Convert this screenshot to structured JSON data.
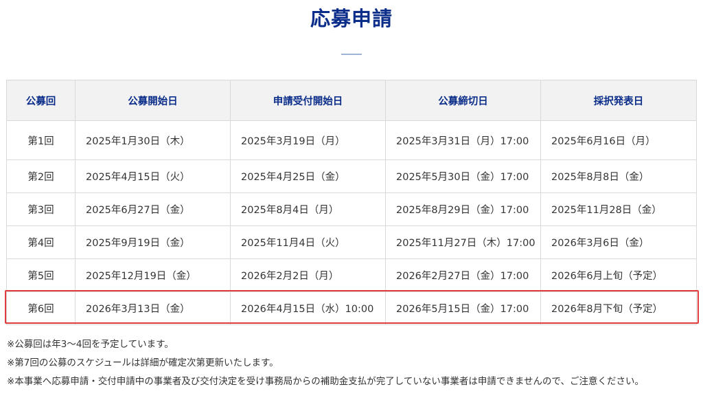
{
  "page": {
    "title": "応募申請"
  },
  "table": {
    "headers": [
      "公募回",
      "公募開始日",
      "申請受付開始日",
      "公募締切日",
      "採択発表日"
    ],
    "rows": [
      [
        "第1回",
        "2025年1月30日（木）",
        "2025年3月19日（月）",
        "2025年3月31日（月）17:00",
        "2025年6月16日（月）"
      ],
      [
        "第2回",
        "2025年4月15日（火）",
        "2025年4月25日（金）",
        "2025年5月30日（金）17:00",
        "2025年8月8日（金）"
      ],
      [
        "第3回",
        "2025年6月27日（金）",
        "2025年8月4日（月）",
        "2025年8月29日（金）17:00",
        "2025年11月28日（金）"
      ],
      [
        "第4回",
        "2025年9月19日（金）",
        "2025年11月4日（火）",
        "2025年11月27日（木）17:00",
        "2026年3月6日（金）"
      ],
      [
        "第5回",
        "2025年12月19日（金）",
        "2026年2月2日（月）",
        "2026年2月27日（金）17:00",
        "2026年6月上旬（予定）"
      ],
      [
        "第6回",
        "2026年3月13日（金）",
        "2026年4月15日（水）10:00",
        "2026年5月15日（金）17:00",
        "2026年8月下旬（予定）"
      ]
    ]
  },
  "notes": [
    "※公募回は年3～4回を予定しています。",
    "※第7回の公募のスケジュールは詳細が確定次第更新いたします。",
    "※本事業へ応募申請・交付申請中の事業者及び交付決定を受け事務局からの補助金支払が完了していない事業者は申請できませんので、ご注意ください。"
  ],
  "colors": {
    "title": "#0b2d8a",
    "highlight_border": "#e03a3a",
    "header_bg": "#f2f2f2"
  }
}
